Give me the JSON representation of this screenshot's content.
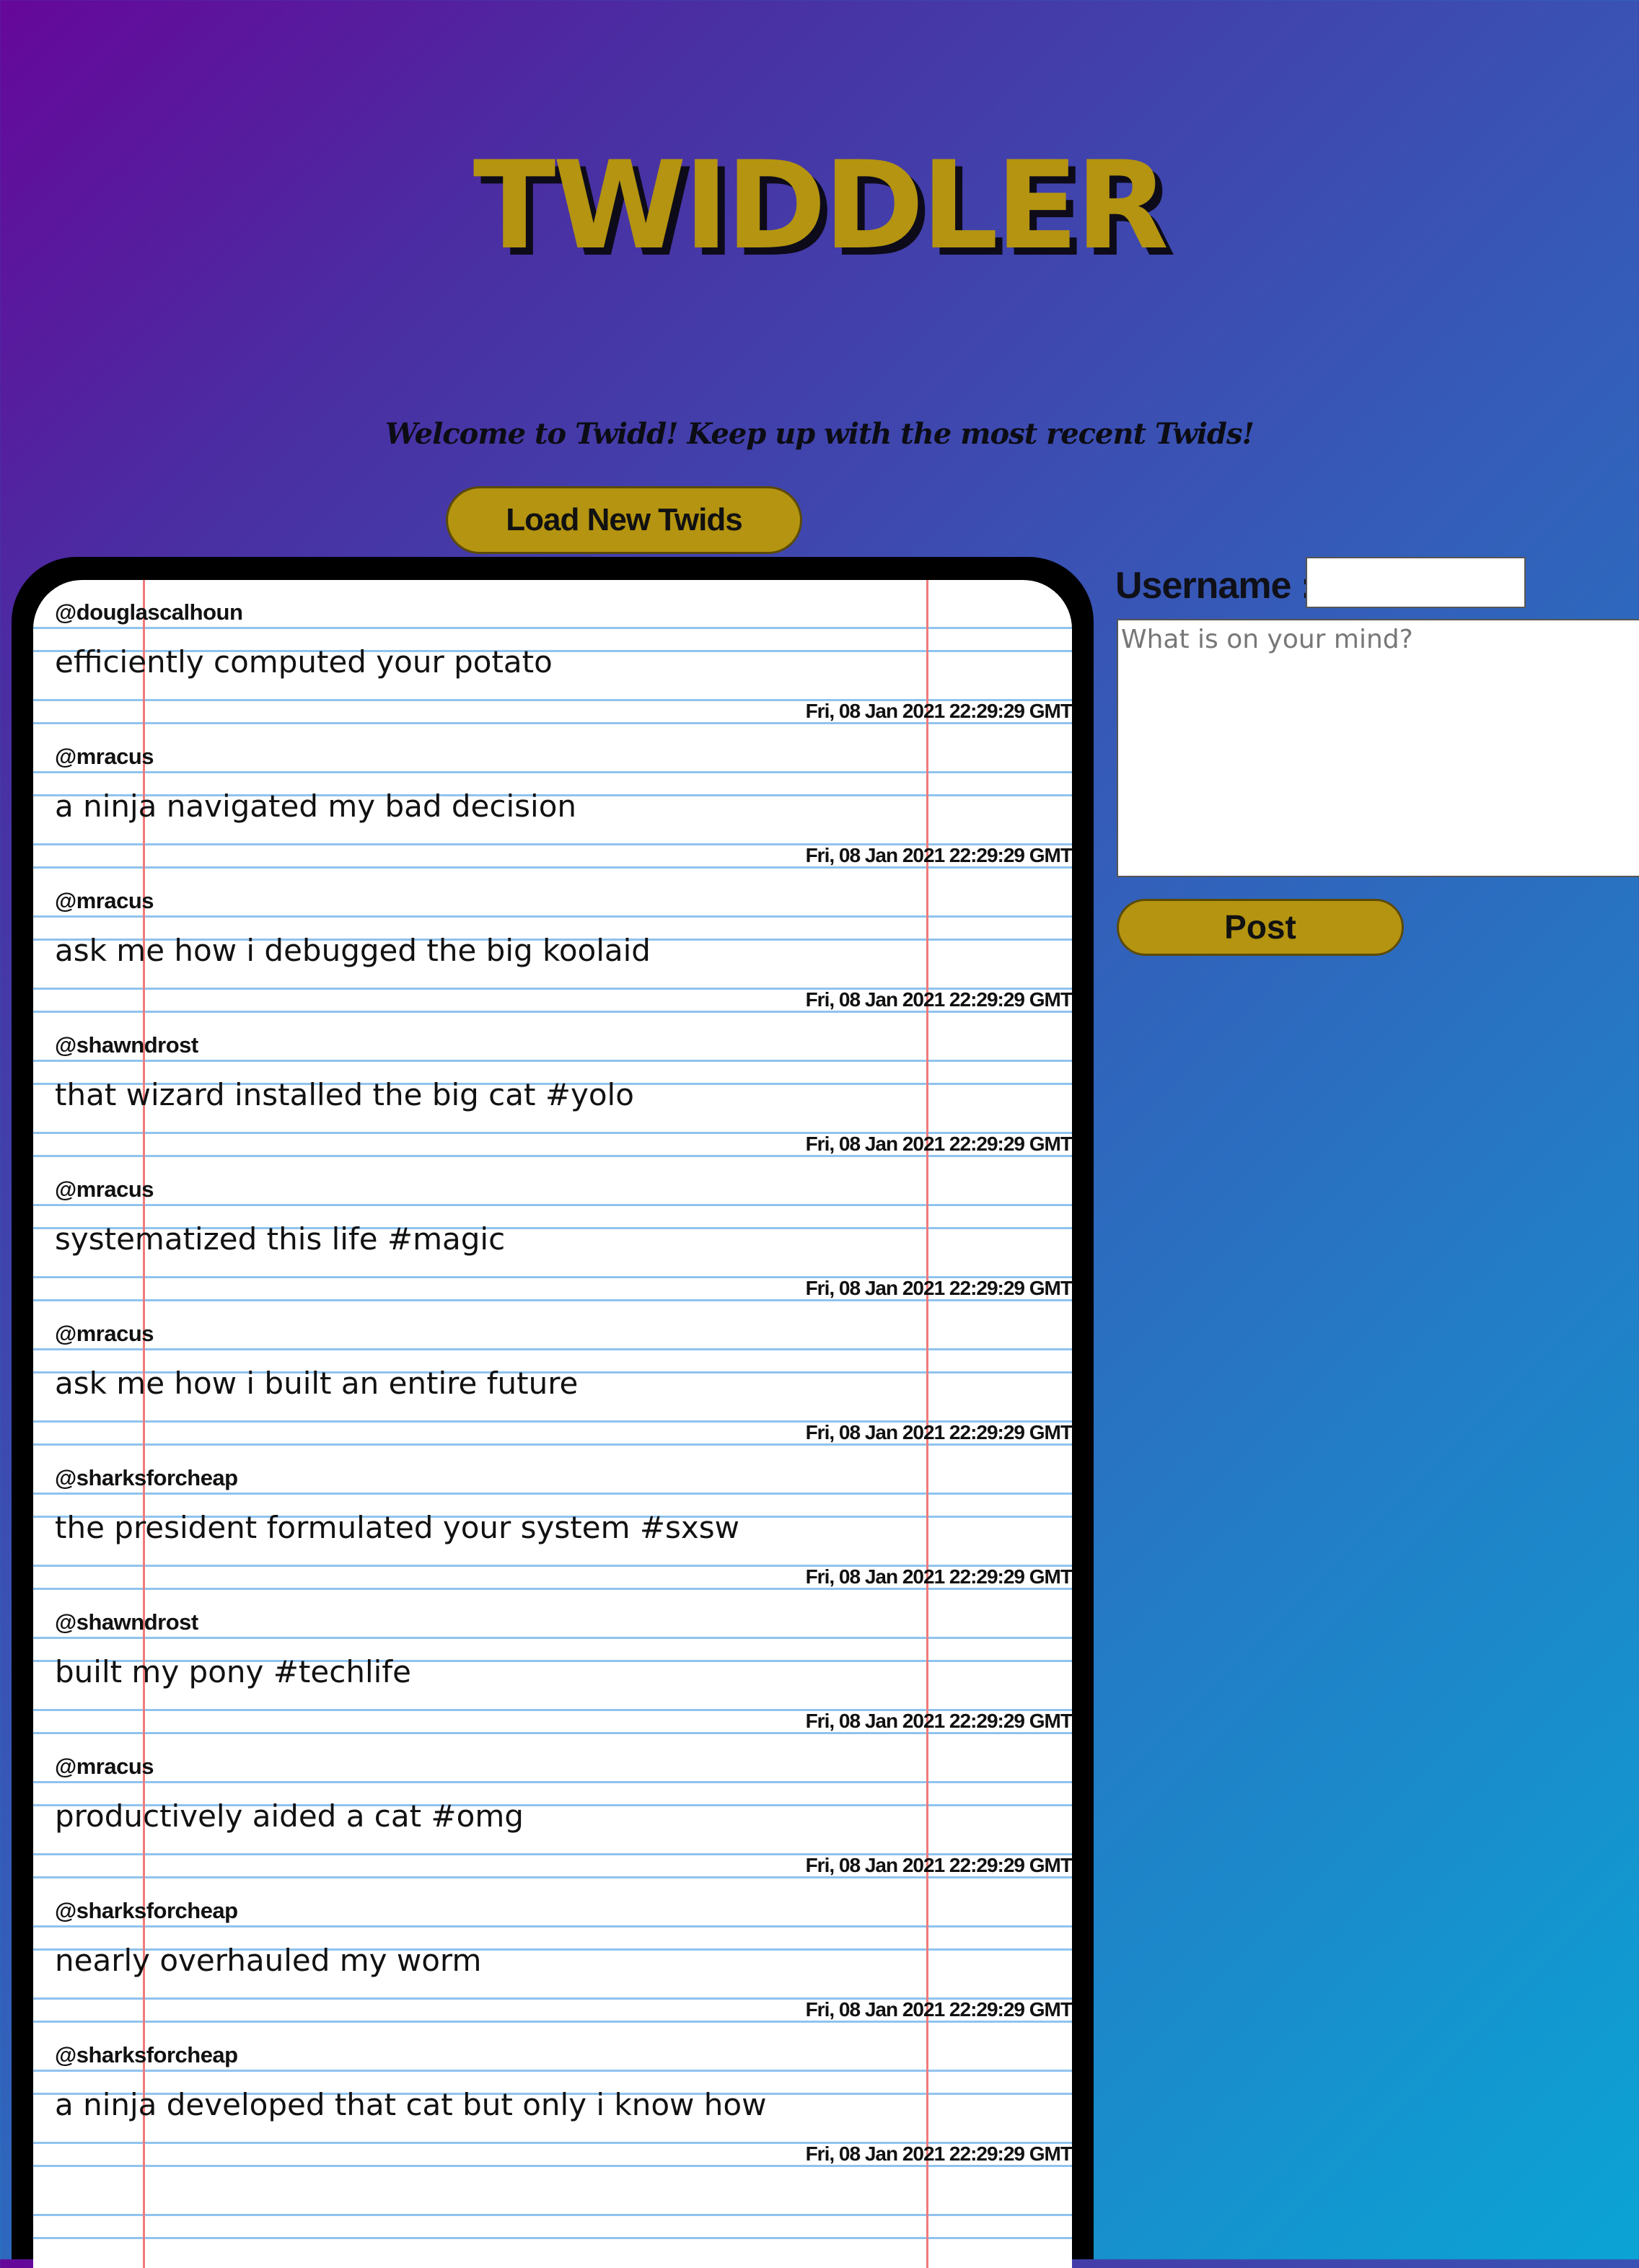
{
  "header": {
    "title": "TWIDDLER",
    "welcome": "Welcome to Twidd! Keep up with the most recent Twids!"
  },
  "feed": {
    "load_button_label": "Load New Twids",
    "twids": [
      {
        "user": "@douglascalhoun",
        "message": "efficiently computed your potato",
        "date": "Fri, 08 Jan 2021 22:29:29 GMT"
      },
      {
        "user": "@mracus",
        "message": "a ninja navigated my bad decision",
        "date": "Fri, 08 Jan 2021 22:29:29 GMT"
      },
      {
        "user": "@mracus",
        "message": "ask me how i debugged the big koolaid",
        "date": "Fri, 08 Jan 2021 22:29:29 GMT"
      },
      {
        "user": "@shawndrost",
        "message": "that wizard installed the big cat #yolo",
        "date": "Fri, 08 Jan 2021 22:29:29 GMT"
      },
      {
        "user": "@mracus",
        "message": "systematized this life #magic",
        "date": "Fri, 08 Jan 2021 22:29:29 GMT"
      },
      {
        "user": "@mracus",
        "message": "ask me how i built an entire future",
        "date": "Fri, 08 Jan 2021 22:29:29 GMT"
      },
      {
        "user": "@sharksforcheap",
        "message": "the president formulated your system #sxsw",
        "date": "Fri, 08 Jan 2021 22:29:29 GMT"
      },
      {
        "user": "@shawndrost",
        "message": "built my pony #techlife",
        "date": "Fri, 08 Jan 2021 22:29:29 GMT"
      },
      {
        "user": "@mracus",
        "message": "productively aided a cat #omg",
        "date": "Fri, 08 Jan 2021 22:29:29 GMT"
      },
      {
        "user": "@sharksforcheap",
        "message": "nearly overhauled my worm",
        "date": "Fri, 08 Jan 2021 22:29:29 GMT"
      },
      {
        "user": "@sharksforcheap",
        "message": "a ninja developed that cat but only i know how",
        "date": "Fri, 08 Jan 2021 22:29:29 GMT"
      }
    ]
  },
  "composer": {
    "username_label": "Username :",
    "username_value": "",
    "message_placeholder": "What is on your mind?",
    "post_button_label": "Post"
  },
  "colors": {
    "accent_gold": "#b49410",
    "paper_rule_blue": "#8fc3ee",
    "paper_margin_red": "#f07a7a"
  }
}
